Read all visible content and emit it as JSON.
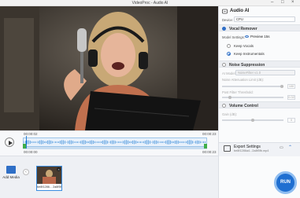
{
  "window": {
    "title": "VideoProc - Audio AI"
  },
  "player": {
    "current_time": "00:00:02",
    "total_time": "00:00:23",
    "in_time": "00:00:00",
    "out_time": "00:00:23"
  },
  "media": {
    "add_label": "Add Media",
    "items": [
      {
        "name": "be8f1286... 2a8f5fb"
      }
    ]
  },
  "panel": {
    "title": "Audio AI",
    "device_label": "Device:",
    "device_value": "CPU",
    "vocal_remover": {
      "title": "Vocal Remover",
      "model_label": "Model Settings:",
      "preview_label": "Preview 15s",
      "options": [
        "Keep Vocals",
        "Keep Instrumentals"
      ],
      "selected": "Keep Instrumentals"
    },
    "noise_suppression": {
      "title": "Noise Suppression",
      "ai_model_label": "AI Model:",
      "ai_model_value": "NoiseFilter v1.0",
      "attenuation_label": "Noise Attenuation Limit (dB):",
      "attenuation_value": "100",
      "threshold_label": "Post Filter Threshold:",
      "threshold_value": "0.02"
    },
    "volume_control": {
      "title": "Volume Control",
      "gain_label": "Gain (dB):",
      "gain_value": "0"
    },
    "export": {
      "title": "Export Settings",
      "subtitle": "be8f1286a4...2a8f5fb.mp4"
    },
    "run_label": "RUN"
  },
  "colors": {
    "accent": "#2f6fc6",
    "run": "#1f6fd1",
    "trim_handle": "#3fae49"
  }
}
